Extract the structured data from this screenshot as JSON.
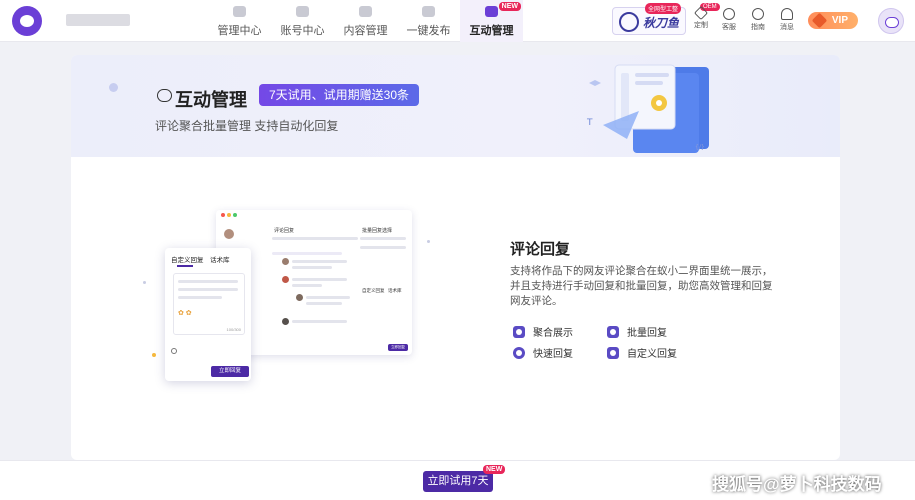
{
  "nav": {
    "items": [
      {
        "label": "管理中心",
        "icon": "dashboard-icon"
      },
      {
        "label": "账号中心",
        "icon": "account-icon"
      },
      {
        "label": "内容管理",
        "icon": "content-icon"
      },
      {
        "label": "一键发布",
        "icon": "publish-icon"
      },
      {
        "label": "互动管理",
        "icon": "interaction-icon",
        "badge": "NEW",
        "active": true
      }
    ]
  },
  "header_right": {
    "brand_text": "秋刀鱼",
    "brand_badge_1": "全网型工整",
    "brand_badge_2": "OEM",
    "tools": [
      {
        "label": "定制",
        "icon": "diamond-icon"
      },
      {
        "label": "客服",
        "icon": "headset-icon"
      },
      {
        "label": "指南",
        "icon": "help-icon"
      },
      {
        "label": "消息",
        "icon": "bell-icon"
      }
    ],
    "vip_label": "VIP"
  },
  "hero": {
    "title": "互动管理",
    "trial_badge": "7天试用、试用期赠送30条",
    "subtitle": "评论聚合批量管理 支持自动化回复"
  },
  "feature": {
    "title": "评论回复",
    "description": "支持将作品下的网友评论聚合在蚁小二界面里统一展示，并且支持进行手动回复和批量回复，助您高效管理和回复网友评论。",
    "items": [
      {
        "label": "聚合展示",
        "icon": "aggregate-icon"
      },
      {
        "label": "批量回复",
        "icon": "batch-reply-icon"
      },
      {
        "label": "快速回复",
        "icon": "quick-reply-icon"
      },
      {
        "label": "自定义回复",
        "icon": "custom-reply-icon"
      }
    ]
  },
  "mockup": {
    "popup_tab_1": "自定义回复",
    "popup_tab_2": "话术库",
    "popup_counter": "100/300",
    "popup_button": "立即回复",
    "panel_title": "评论回复",
    "panel_right_title": "批量回复选择",
    "panel_right_tab_1": "自定义回复",
    "panel_right_tab_2": "话术库",
    "panel_send": "立即回复"
  },
  "bottom": {
    "try_button": "立即试用7天",
    "try_badge": "NEW"
  },
  "watermark": "搜狐号@萝卜科技数码",
  "colors": {
    "accent": "#4c2aa5",
    "brand_purple": "#6b3fd6",
    "badge_red": "#e8265a",
    "vip_orange": "#ff9a5f"
  }
}
